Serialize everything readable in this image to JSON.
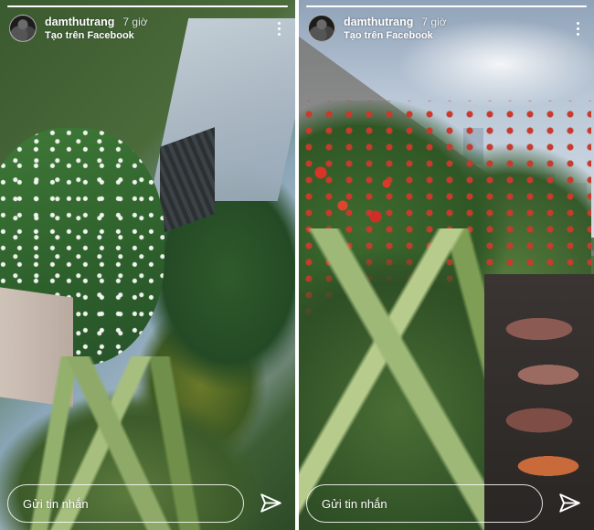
{
  "stories": [
    {
      "username": "damthutrang",
      "time": "7 giờ",
      "source": "Tạo trên Facebook",
      "progress_fraction": 1.0,
      "reply_placeholder": "Gửi tin nhắn",
      "icons": {
        "more": "more-vertical-icon",
        "send": "send-icon"
      }
    },
    {
      "username": "damthutrang",
      "time": "7 giờ",
      "source": "Tạo trên Facebook",
      "progress_fraction": 1.0,
      "reply_placeholder": "Gửi tin nhắn",
      "icons": {
        "more": "more-vertical-icon",
        "send": "send-icon"
      }
    }
  ]
}
